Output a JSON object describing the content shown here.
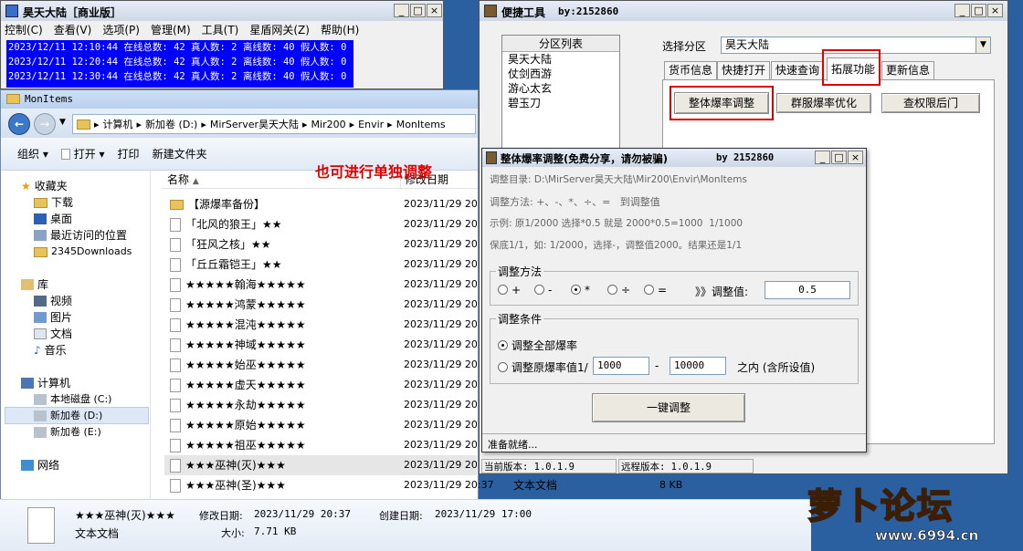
{
  "log_window": {
    "title": "昊天大陆［商业版］",
    "menu": [
      "控制(C)",
      "查看(V)",
      "选项(P)",
      "管理(M)",
      "工具(T)",
      "星盾网关(Z)",
      "帮助(H)"
    ],
    "lines": [
      "2023/12/11 12:10:44 在线总数: 42 真人数: 2 离线数: 40 假人数: 0",
      "2023/12/11 12:20:44 在线总数: 42 真人数: 2 离线数: 40 假人数: 0",
      "2023/12/11 12:30:44 在线总数: 42 真人数: 2 离线数: 40 假人数: 0"
    ]
  },
  "explorer": {
    "title": "MonItems",
    "address": [
      "计算机",
      "新加卷 (D:)",
      "MirServer昊天大陆",
      "Mir200",
      "Envir",
      "MonItems"
    ],
    "toolbar": {
      "organize": "组织",
      "open": "打开",
      "print": "打印",
      "new_folder": "新建文件夹"
    },
    "columns": {
      "name": "名称",
      "modified": "修改日期"
    },
    "annotation": "也可进行单独调整",
    "nav": {
      "favorites": "收藏夹",
      "downloads": "下载",
      "desktop": "桌面",
      "recent": "最近访问的位置",
      "dl2345": "2345Downloads",
      "library": "库",
      "videos": "视频",
      "pictures": "图片",
      "documents": "文档",
      "music": "音乐",
      "computer": "计算机",
      "local_disk": "本地磁盘 (C:)",
      "new_vol_d": "新加卷 (D:)",
      "new_vol_e": "新加卷 (E:)",
      "network": "网络"
    },
    "files": [
      {
        "name": "【源爆率备份】",
        "date": "2023/11/29 20"
      },
      {
        "name": "「北风的狼王」★★",
        "date": "2023/11/29 20"
      },
      {
        "name": "「狂风之核」★★",
        "date": "2023/11/29 20"
      },
      {
        "name": "「丘丘霜铠王」★★",
        "date": "2023/11/29 20"
      },
      {
        "name": "★★★★★翰海★★★★★",
        "date": "2023/11/29 20"
      },
      {
        "name": "★★★★★鸿蒙★★★★★",
        "date": "2023/11/29 20"
      },
      {
        "name": "★★★★★混沌★★★★★",
        "date": "2023/11/29 20"
      },
      {
        "name": "★★★★★神域★★★★★",
        "date": "2023/11/29 20"
      },
      {
        "name": "★★★★★始巫★★★★★",
        "date": "2023/11/29 20"
      },
      {
        "name": "★★★★★虚天★★★★★",
        "date": "2023/11/29 20"
      },
      {
        "name": "★★★★★永劫★★★★★",
        "date": "2023/11/29 20"
      },
      {
        "name": "★★★★★原始★★★★★",
        "date": "2023/11/29 20"
      },
      {
        "name": "★★★★★祖巫★★★★★",
        "date": "2023/11/29 20"
      },
      {
        "name": "★★★巫神(灭)★★★",
        "date": "2023/11/29 20"
      },
      {
        "name": "★★★巫神(圣)★★★",
        "date": "2023/11/29 20:37"
      }
    ],
    "last_row_type": "文本文档",
    "last_row_size": "8 KB",
    "details": {
      "name": "★★★巫神(灭)★★★",
      "modified_label": "修改日期:",
      "modified": "2023/11/29 20:37",
      "created_label": "创建日期:",
      "created": "2023/11/29 17:00",
      "type": "文本文档",
      "size_label": "大小:",
      "size": "7.71 KB"
    }
  },
  "quick_tool": {
    "title": "便捷工具",
    "author": "by:2152860",
    "partition_list_header": "分区列表",
    "partitions": [
      "昊天大陆",
      "仗剑西游",
      "游心太玄",
      "碧玉刀"
    ],
    "select_label": "选择分区",
    "selected": "昊天大陆",
    "tabs": [
      "货币信息",
      "快捷打开",
      "快速查询",
      "拓展功能",
      "更新信息"
    ],
    "buttons": [
      "整体爆率调整",
      "群服爆率优化",
      "查权限后门"
    ],
    "status_current": "当前版本: 1.0.1.9",
    "status_remote": "远程版本: 1.0.1.9"
  },
  "adjust_dialog": {
    "title": "整体爆率调整(免费分享，请勿被骗)",
    "author": "by 2152860",
    "dir": "调整目录: D:\\MirServer昊天大陆\\Mir200\\Envir\\MonItems",
    "method_line": "调整方法: +、-、*、÷、=   到调整值",
    "example": "示例: 原1/2000 选择*0.5 就是 2000*0.5=1000  1/1000",
    "guarantee": "保底1/1，如: 1/2000，选择-，调整值2000。结果还是1/1",
    "method_group": "调整方法",
    "ops": [
      "+",
      "-",
      "*",
      "÷",
      "="
    ],
    "adjust_value_label": "》》调整值:",
    "adjust_value": "0.5",
    "cond_group": "调整条件",
    "cond_all": "调整全部爆率",
    "cond_range": "调整原爆率值1/",
    "range_from": "1000",
    "range_to": "10000",
    "range_dash": "-",
    "range_suffix": "之内 (含所设值)",
    "apply": "一键调整",
    "status": "准备就绪..."
  },
  "watermark": {
    "brand": "萝卜论坛",
    "url": "www.6994.cn"
  }
}
